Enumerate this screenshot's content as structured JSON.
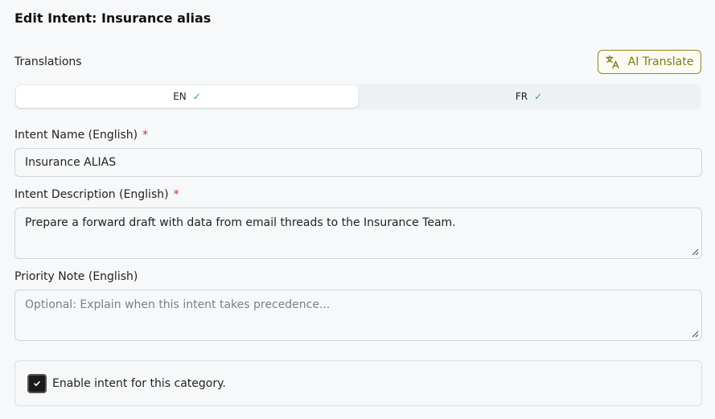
{
  "dialog": {
    "title": "Edit Intent: Insurance alias"
  },
  "translations": {
    "label": "Translations",
    "ai_button_label": "AI Translate",
    "ai_icon": "translate-icon",
    "tabs": [
      {
        "code": "EN",
        "status": "✓",
        "active": true
      },
      {
        "code": "FR",
        "status": "✓",
        "active": false
      }
    ],
    "status_color": "#2f9e6a"
  },
  "fields": {
    "name": {
      "label": "Intent Name (English)",
      "required_mark": "*",
      "value": "Insurance ALIAS"
    },
    "description": {
      "label": "Intent Description (English)",
      "required_mark": "*",
      "value": "Prepare a forward draft with data from email threads to the Insurance Team."
    },
    "priority": {
      "label": "Priority Note (English)",
      "placeholder": "Optional: Explain when this intent takes precedence..."
    }
  },
  "enable": {
    "label": "Enable intent for this category.",
    "checked": true
  },
  "colors": {
    "accent": "#8f8a1e",
    "required": "#d32f2f"
  }
}
